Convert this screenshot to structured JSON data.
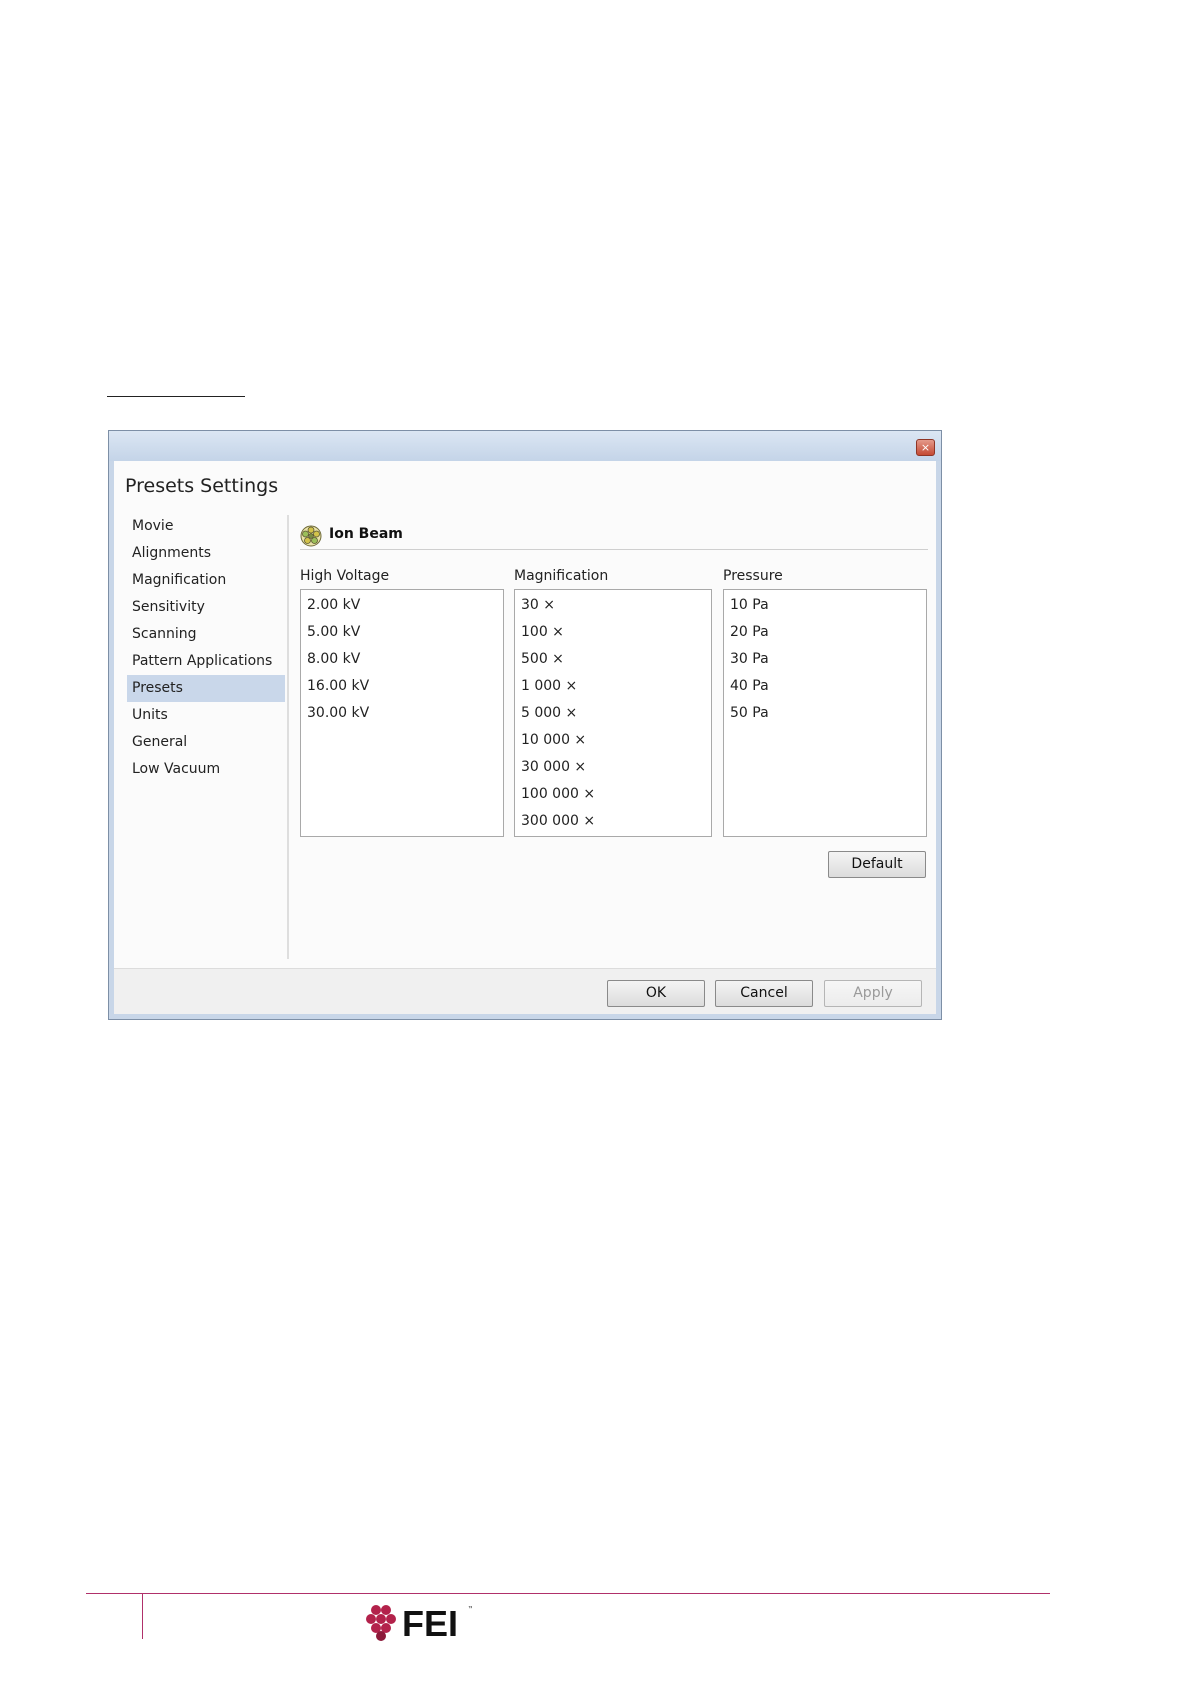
{
  "dialog": {
    "title": "Presets Settings",
    "close_label": "×"
  },
  "sidebar": {
    "items": [
      {
        "label": "Movie"
      },
      {
        "label": "Alignments"
      },
      {
        "label": "Magnification"
      },
      {
        "label": "Sensitivity"
      },
      {
        "label": "Scanning"
      },
      {
        "label": "Pattern Applications"
      },
      {
        "label": "Presets",
        "selected": true
      },
      {
        "label": "Units"
      },
      {
        "label": "General"
      },
      {
        "label": "Low Vacuum"
      }
    ]
  },
  "beam": {
    "title": "Ion Beam",
    "icon": "ion-beam-icon"
  },
  "columns": {
    "high_voltage": {
      "label": "High Voltage",
      "items": [
        "2.00 kV",
        "5.00 kV",
        "8.00 kV",
        "16.00 kV",
        "30.00 kV"
      ]
    },
    "magnification": {
      "label": "Magnification",
      "items": [
        "30 ×",
        "100 ×",
        "500 ×",
        "1 000 ×",
        "5 000 ×",
        "10 000 ×",
        "30 000 ×",
        "100 000 ×",
        "300 000 ×"
      ]
    },
    "pressure": {
      "label": "Pressure",
      "items": [
        "10 Pa",
        "20 Pa",
        "30 Pa",
        "40 Pa",
        "50 Pa"
      ]
    }
  },
  "buttons": {
    "default": "Default",
    "ok": "OK",
    "cancel": "Cancel",
    "apply": "Apply"
  },
  "brand": {
    "logo_text": "FEI",
    "accent_color": "#b0306a",
    "logo_color": "#b3224b"
  }
}
